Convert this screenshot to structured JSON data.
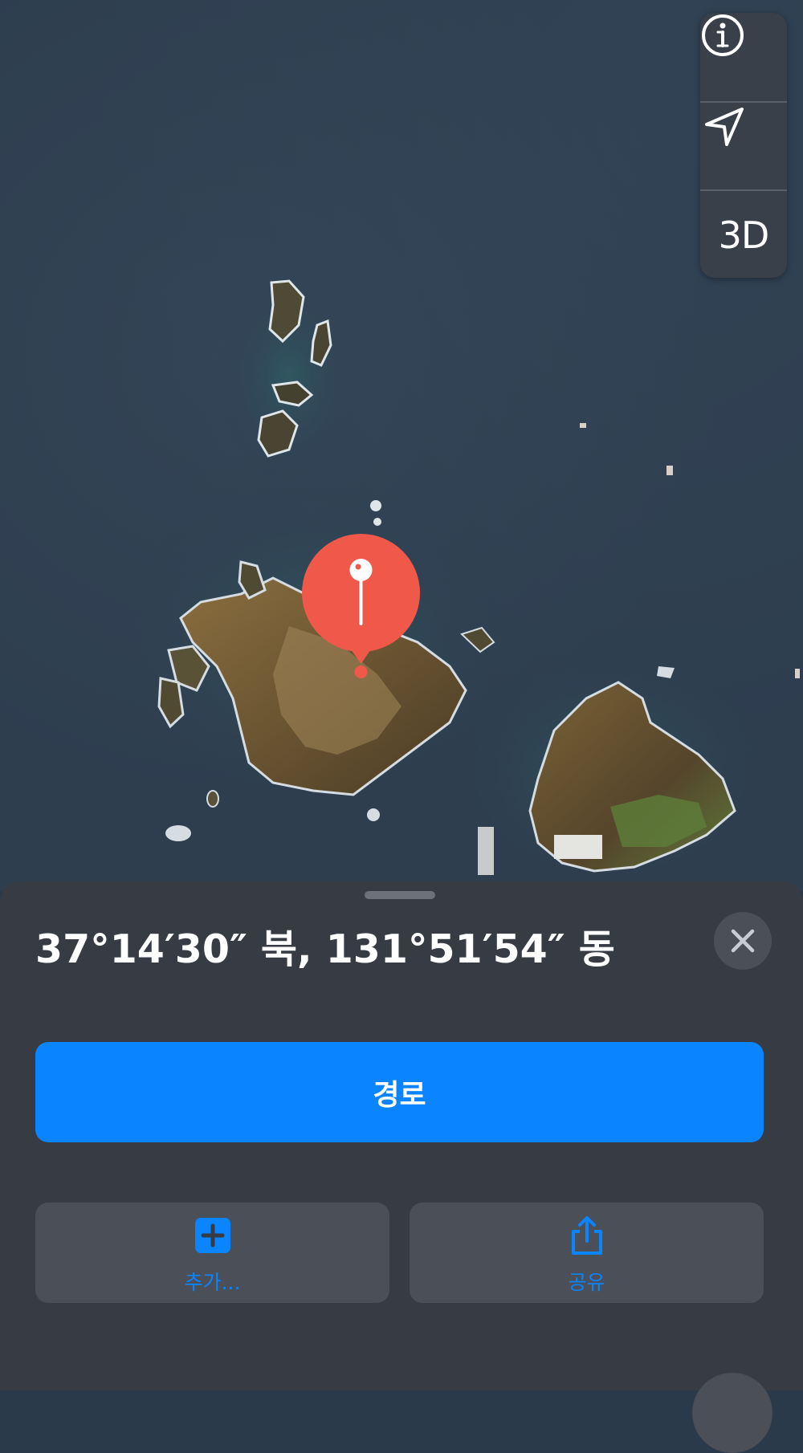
{
  "map": {
    "controls": {
      "info_icon": "info-circle-icon",
      "location_icon": "location-arrow-icon",
      "three_d_label": "3D"
    },
    "pin_color": "#f0594a"
  },
  "sheet": {
    "title": "37°14′30″ 북, 131°51′54″ 동",
    "close_icon": "close-icon",
    "route_label": "경로",
    "actions": [
      {
        "label": "추가...",
        "icon": "plus-square-icon"
      },
      {
        "label": "공유",
        "icon": "share-icon"
      }
    ]
  },
  "colors": {
    "accent": "#0a84ff",
    "sheet_bg": "#363b44",
    "button_bg": "#4a4f58"
  }
}
